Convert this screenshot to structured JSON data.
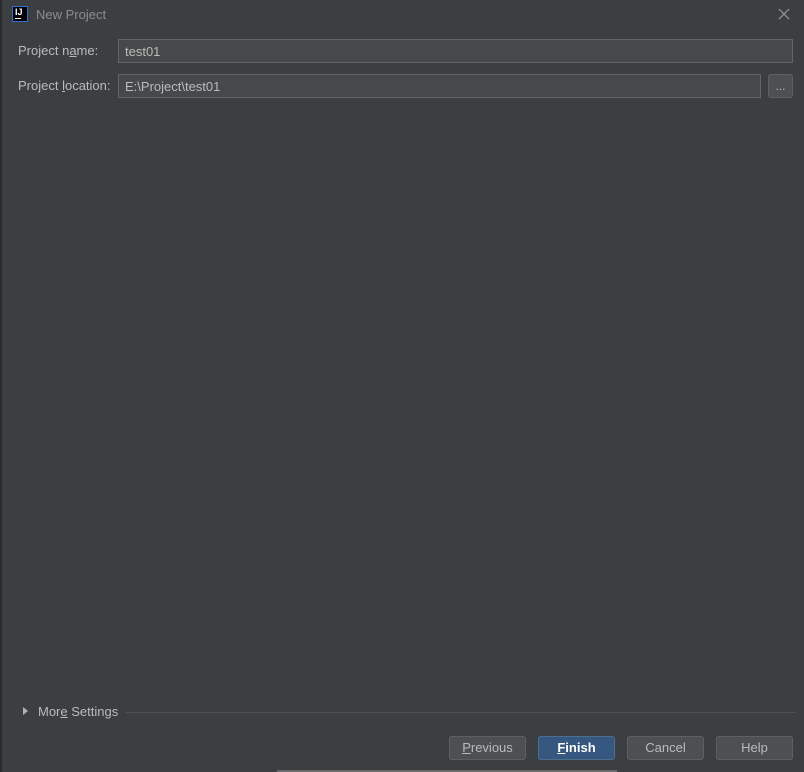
{
  "window": {
    "title": "New Project"
  },
  "form": {
    "project_name": {
      "label_pre": "Project n",
      "label_acc": "a",
      "label_post": "me:",
      "value": "test01"
    },
    "project_location": {
      "label_pre": "Project ",
      "label_acc": "l",
      "label_post": "ocation:",
      "value": "E:\\Project\\test01"
    },
    "browse_label": "..."
  },
  "more_settings": {
    "label_pre": "Mor",
    "label_acc": "e",
    "label_post": " Settings"
  },
  "buttons": {
    "previous": {
      "acc": "P",
      "rest": "revious"
    },
    "finish": {
      "acc": "F",
      "rest": "inish"
    },
    "cancel": "Cancel",
    "help": "Help"
  },
  "icons": {
    "app": "intellij-idea-icon",
    "close": "close-icon",
    "expand": "triangle-right-icon"
  },
  "colors": {
    "background": "#3c3f41",
    "input_background": "#45494a",
    "primary_button": "#365880",
    "text": "#bbbbbb"
  }
}
